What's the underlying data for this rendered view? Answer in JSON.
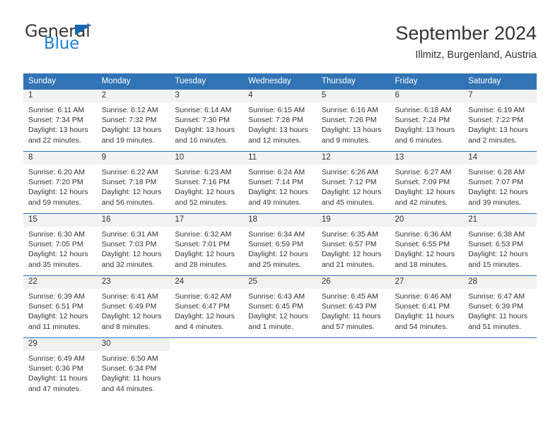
{
  "brand": {
    "name_top": "General",
    "name_bottom": "Blue",
    "accent_color": "#1f7fd4",
    "triangle_color": "#1565b0"
  },
  "header": {
    "title": "September 2024",
    "subtitle": "Illmitz, Burgenland, Austria"
  },
  "calendar": {
    "header_bg": "#3174b5",
    "header_text_color": "#ffffff",
    "daynum_band_bg": "#f2f2f2",
    "weekday_headers": [
      "Sunday",
      "Monday",
      "Tuesday",
      "Wednesday",
      "Thursday",
      "Friday",
      "Saturday"
    ],
    "weeks": [
      [
        {
          "day": "1",
          "sunrise": "Sunrise: 6:11 AM",
          "sunset": "Sunset: 7:34 PM",
          "daylight": "Daylight: 13 hours and 22 minutes."
        },
        {
          "day": "2",
          "sunrise": "Sunrise: 6:12 AM",
          "sunset": "Sunset: 7:32 PM",
          "daylight": "Daylight: 13 hours and 19 minutes."
        },
        {
          "day": "3",
          "sunrise": "Sunrise: 6:14 AM",
          "sunset": "Sunset: 7:30 PM",
          "daylight": "Daylight: 13 hours and 16 minutes."
        },
        {
          "day": "4",
          "sunrise": "Sunrise: 6:15 AM",
          "sunset": "Sunset: 7:28 PM",
          "daylight": "Daylight: 13 hours and 12 minutes."
        },
        {
          "day": "5",
          "sunrise": "Sunrise: 6:16 AM",
          "sunset": "Sunset: 7:26 PM",
          "daylight": "Daylight: 13 hours and 9 minutes."
        },
        {
          "day": "6",
          "sunrise": "Sunrise: 6:18 AM",
          "sunset": "Sunset: 7:24 PM",
          "daylight": "Daylight: 13 hours and 6 minutes."
        },
        {
          "day": "7",
          "sunrise": "Sunrise: 6:19 AM",
          "sunset": "Sunset: 7:22 PM",
          "daylight": "Daylight: 13 hours and 2 minutes."
        }
      ],
      [
        {
          "day": "8",
          "sunrise": "Sunrise: 6:20 AM",
          "sunset": "Sunset: 7:20 PM",
          "daylight": "Daylight: 12 hours and 59 minutes."
        },
        {
          "day": "9",
          "sunrise": "Sunrise: 6:22 AM",
          "sunset": "Sunset: 7:18 PM",
          "daylight": "Daylight: 12 hours and 56 minutes."
        },
        {
          "day": "10",
          "sunrise": "Sunrise: 6:23 AM",
          "sunset": "Sunset: 7:16 PM",
          "daylight": "Daylight: 12 hours and 52 minutes."
        },
        {
          "day": "11",
          "sunrise": "Sunrise: 6:24 AM",
          "sunset": "Sunset: 7:14 PM",
          "daylight": "Daylight: 12 hours and 49 minutes."
        },
        {
          "day": "12",
          "sunrise": "Sunrise: 6:26 AM",
          "sunset": "Sunset: 7:12 PM",
          "daylight": "Daylight: 12 hours and 45 minutes."
        },
        {
          "day": "13",
          "sunrise": "Sunrise: 6:27 AM",
          "sunset": "Sunset: 7:09 PM",
          "daylight": "Daylight: 12 hours and 42 minutes."
        },
        {
          "day": "14",
          "sunrise": "Sunrise: 6:28 AM",
          "sunset": "Sunset: 7:07 PM",
          "daylight": "Daylight: 12 hours and 39 minutes."
        }
      ],
      [
        {
          "day": "15",
          "sunrise": "Sunrise: 6:30 AM",
          "sunset": "Sunset: 7:05 PM",
          "daylight": "Daylight: 12 hours and 35 minutes."
        },
        {
          "day": "16",
          "sunrise": "Sunrise: 6:31 AM",
          "sunset": "Sunset: 7:03 PM",
          "daylight": "Daylight: 12 hours and 32 minutes."
        },
        {
          "day": "17",
          "sunrise": "Sunrise: 6:32 AM",
          "sunset": "Sunset: 7:01 PM",
          "daylight": "Daylight: 12 hours and 28 minutes."
        },
        {
          "day": "18",
          "sunrise": "Sunrise: 6:34 AM",
          "sunset": "Sunset: 6:59 PM",
          "daylight": "Daylight: 12 hours and 25 minutes."
        },
        {
          "day": "19",
          "sunrise": "Sunrise: 6:35 AM",
          "sunset": "Sunset: 6:57 PM",
          "daylight": "Daylight: 12 hours and 21 minutes."
        },
        {
          "day": "20",
          "sunrise": "Sunrise: 6:36 AM",
          "sunset": "Sunset: 6:55 PM",
          "daylight": "Daylight: 12 hours and 18 minutes."
        },
        {
          "day": "21",
          "sunrise": "Sunrise: 6:38 AM",
          "sunset": "Sunset: 6:53 PM",
          "daylight": "Daylight: 12 hours and 15 minutes."
        }
      ],
      [
        {
          "day": "22",
          "sunrise": "Sunrise: 6:39 AM",
          "sunset": "Sunset: 6:51 PM",
          "daylight": "Daylight: 12 hours and 11 minutes."
        },
        {
          "day": "23",
          "sunrise": "Sunrise: 6:41 AM",
          "sunset": "Sunset: 6:49 PM",
          "daylight": "Daylight: 12 hours and 8 minutes."
        },
        {
          "day": "24",
          "sunrise": "Sunrise: 6:42 AM",
          "sunset": "Sunset: 6:47 PM",
          "daylight": "Daylight: 12 hours and 4 minutes."
        },
        {
          "day": "25",
          "sunrise": "Sunrise: 6:43 AM",
          "sunset": "Sunset: 6:45 PM",
          "daylight": "Daylight: 12 hours and 1 minute."
        },
        {
          "day": "26",
          "sunrise": "Sunrise: 6:45 AM",
          "sunset": "Sunset: 6:43 PM",
          "daylight": "Daylight: 11 hours and 57 minutes."
        },
        {
          "day": "27",
          "sunrise": "Sunrise: 6:46 AM",
          "sunset": "Sunset: 6:41 PM",
          "daylight": "Daylight: 11 hours and 54 minutes."
        },
        {
          "day": "28",
          "sunrise": "Sunrise: 6:47 AM",
          "sunset": "Sunset: 6:39 PM",
          "daylight": "Daylight: 11 hours and 51 minutes."
        }
      ],
      [
        {
          "day": "29",
          "sunrise": "Sunrise: 6:49 AM",
          "sunset": "Sunset: 6:36 PM",
          "daylight": "Daylight: 11 hours and 47 minutes."
        },
        {
          "day": "30",
          "sunrise": "Sunrise: 6:50 AM",
          "sunset": "Sunset: 6:34 PM",
          "daylight": "Daylight: 11 hours and 44 minutes."
        },
        null,
        null,
        null,
        null,
        null
      ]
    ]
  }
}
